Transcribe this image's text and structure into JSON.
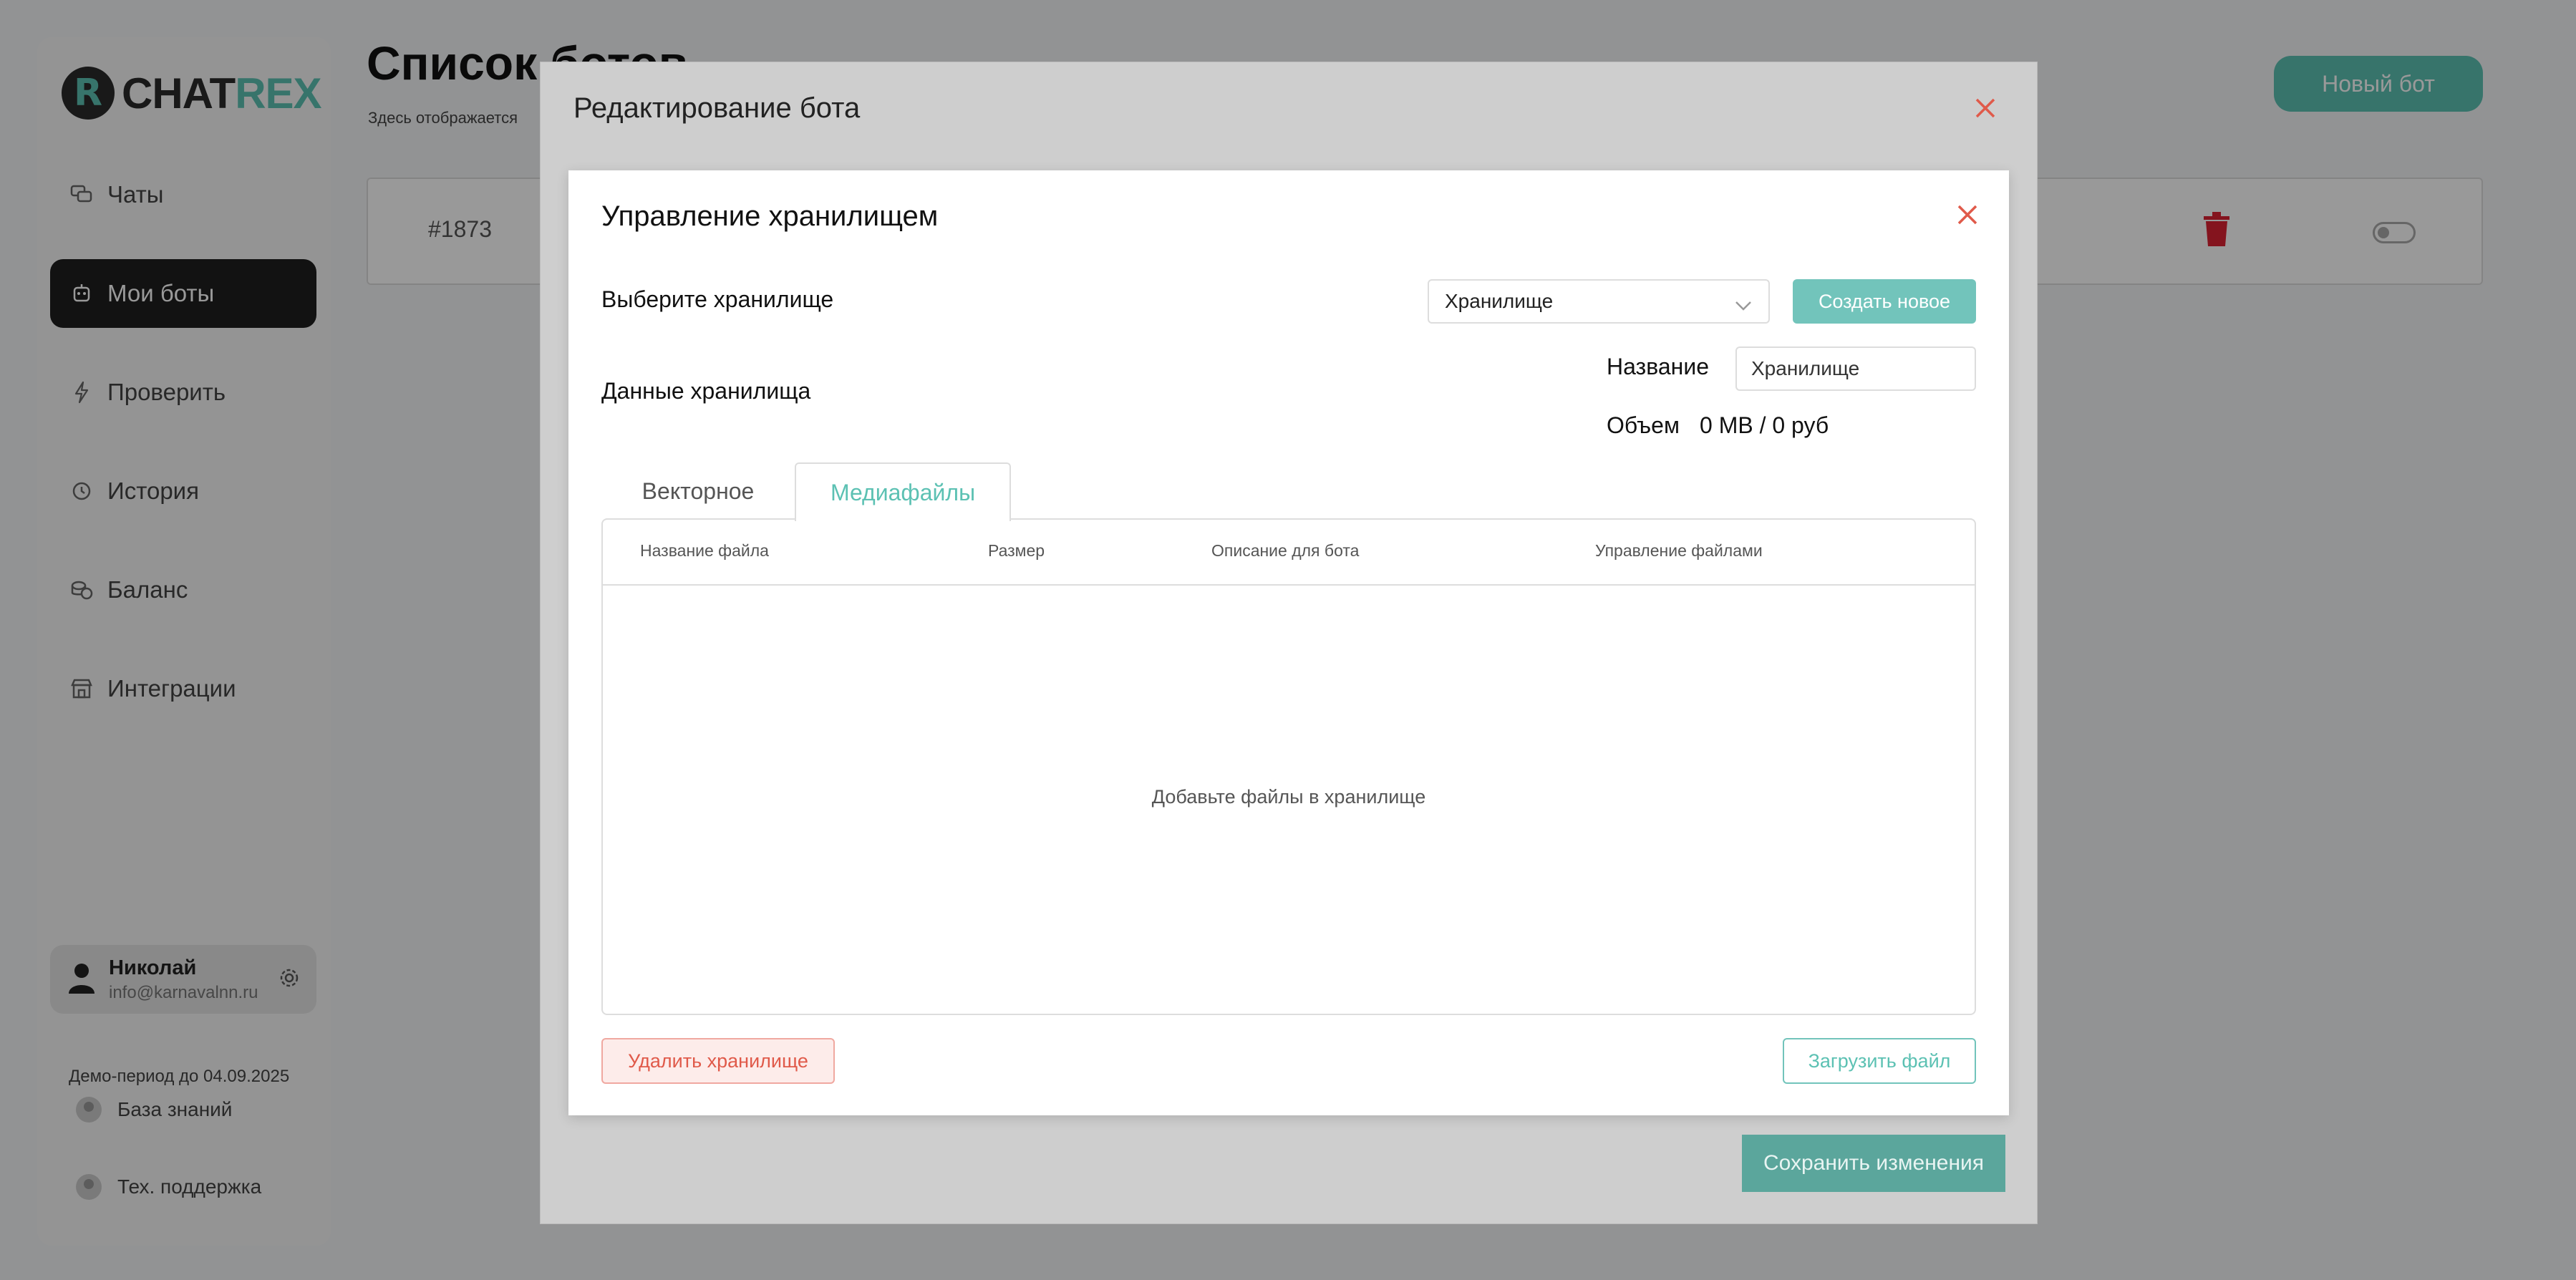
{
  "app": {
    "logo_letter": "R",
    "logo_part1": "CHAT",
    "logo_part2": "REX",
    "brand_color": "#5cc1b3"
  },
  "sidebar": {
    "items": [
      {
        "label": "Чаты",
        "icon": "chats-icon"
      },
      {
        "label": "Мои боты",
        "icon": "bot-icon",
        "active": true
      },
      {
        "label": "Проверить",
        "icon": "lightning-icon"
      },
      {
        "label": "История",
        "icon": "history-icon"
      },
      {
        "label": "Баланс",
        "icon": "coins-icon"
      },
      {
        "label": "Интеграции",
        "icon": "store-icon"
      }
    ],
    "user": {
      "name": "Николай",
      "email": "info@karnavalnn.ru"
    },
    "demo_text": "Демо-период до 04.09.2025",
    "knowledge_base": "База знаний",
    "support": "Тех. поддержка"
  },
  "main": {
    "title": "Список ботов",
    "subtitle": "Здесь отображается",
    "new_bot_label": "Новый бот",
    "bot_row": {
      "id": "#1873"
    }
  },
  "outer_modal": {
    "title": "Редактирование бота",
    "save_label": "Сохранить изменения"
  },
  "storage_modal": {
    "title": "Управление хранилищем",
    "select_label": "Выберите хранилище",
    "select_value": "Хранилище",
    "create_label": "Создать новое",
    "data_label": "Данные хранилища",
    "name_label": "Название",
    "name_value": "Хранилище",
    "volume_label": "Объем",
    "volume_value": "0 MB / 0 руб",
    "tabs": [
      {
        "label": "Векторное",
        "active": false
      },
      {
        "label": "Медиафайлы",
        "active": true
      }
    ],
    "columns": [
      "Название файла",
      "Размер",
      "Описание для бота",
      "Управление файлами"
    ],
    "empty_text": "Добавьте файлы в хранилище",
    "delete_label": "Удалить хранилище",
    "upload_label": "Загрузить файл"
  },
  "colors": {
    "accent": "#5cc1b3",
    "danger": "#e05a4a",
    "overlay": "rgba(0,0,0,0.4)"
  }
}
